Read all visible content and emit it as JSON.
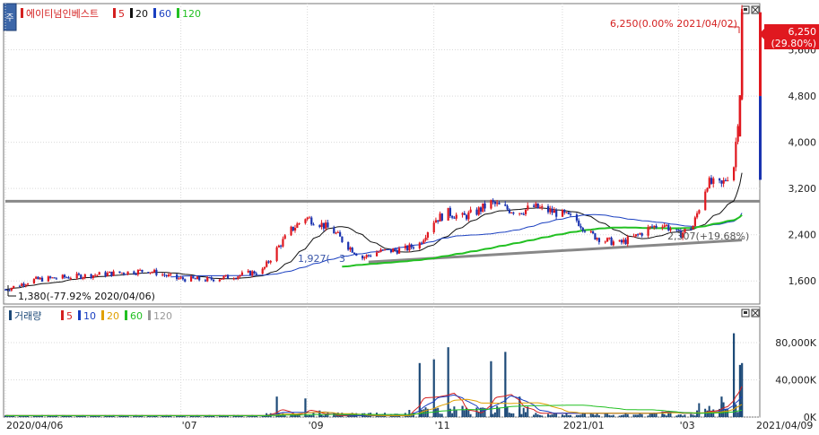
{
  "price_panel": {
    "stock_name": "에이티넘인베스트",
    "ma_labels": [
      "5",
      "20",
      "60",
      "120"
    ],
    "ma_colors": [
      "#d42020",
      "#111111",
      "#1a3fc0",
      "#22c022"
    ],
    "high_annotation": "6,250(0.00% 2021/04/02)",
    "low_annotation": "1,380(-77.92% 2020/04/06)",
    "trendline_annotation": "1,927(",
    "trendline_annotation_fragment": "3",
    "trendline_end_annotation": "2,307(+19.68%)",
    "current_price_label": "6,250",
    "current_change_label": "(29.80%)"
  },
  "volume_panel": {
    "title": "거래량",
    "ma_labels": [
      "5",
      "10",
      "20",
      "60",
      "120"
    ],
    "ma_colors": [
      "#d42020",
      "#1a3fc0",
      "#e0a000",
      "#22c022",
      "#999999"
    ]
  },
  "colors": {
    "up": "#e0181f",
    "down": "#1a33b0",
    "volume_bar": "#1d4a78",
    "support_line": "#888888",
    "current_price_bg": "#e0181f"
  },
  "chart_data": [
    {
      "type": "candlestick",
      "title": "에이티넘인베스트",
      "y_ticks": [
        "5,600",
        "4,800",
        "4,000",
        "3,200",
        "2,400",
        "1,600"
      ],
      "y_tick_values": [
        5600,
        4800,
        4000,
        3200,
        2400,
        1600
      ],
      "ylim": [
        1200,
        6400
      ],
      "x_ticks": [
        "2020/04/06",
        "'07",
        "'09",
        "'11",
        "2021/01",
        "'03",
        "2021/04/09"
      ],
      "x_tick_dates": [
        "2020-04-06",
        "2020-07-01",
        "2020-09-01",
        "2020-11-02",
        "2021-01-04",
        "2021-03-02",
        "2021-04-09"
      ],
      "x_range": [
        "2020-04-06",
        "2021-04-09"
      ],
      "period_low": {
        "date": "2020-04-06",
        "value": 1380
      },
      "period_high": {
        "date": "2021-04-02",
        "value": 6250
      },
      "last_close": 6250,
      "last_change_pct": 29.8,
      "horizontal_line": 2980,
      "support_trendline": {
        "start_date": "2020-10-01",
        "start_value": 1927,
        "end_date": "2021-04-02",
        "end_value": 2307
      },
      "series": [
        {
          "name": "Close",
          "points": [
            [
              "2020-04-06",
              1450
            ],
            [
              "2020-04-20",
              1620
            ],
            [
              "2020-05-04",
              1660
            ],
            [
              "2020-05-18",
              1700
            ],
            [
              "2020-06-01",
              1740
            ],
            [
              "2020-06-15",
              1780
            ],
            [
              "2020-06-29",
              1640
            ],
            [
              "2020-07-13",
              1620
            ],
            [
              "2020-07-27",
              1680
            ],
            [
              "2020-08-10",
              1780
            ],
            [
              "2020-08-17",
              2150
            ],
            [
              "2020-08-24",
              2480
            ],
            [
              "2020-08-31",
              2700
            ],
            [
              "2020-09-07",
              2600
            ],
            [
              "2020-09-14",
              2450
            ],
            [
              "2020-09-21",
              2200
            ],
            [
              "2020-09-28",
              2000
            ],
            [
              "2020-10-05",
              2100
            ],
            [
              "2020-10-19",
              2150
            ],
            [
              "2020-10-26",
              2250
            ],
            [
              "2020-11-02",
              2650
            ],
            [
              "2020-11-09",
              2780
            ],
            [
              "2020-11-16",
              2700
            ],
            [
              "2020-11-23",
              2800
            ],
            [
              "2020-11-30",
              2950
            ],
            [
              "2020-12-07",
              2850
            ],
            [
              "2020-12-14",
              2800
            ],
            [
              "2020-12-21",
              2880
            ],
            [
              "2021-01-04",
              2750
            ],
            [
              "2021-01-11",
              2650
            ],
            [
              "2021-01-18",
              2400
            ],
            [
              "2021-01-25",
              2300
            ],
            [
              "2021-02-01",
              2250
            ],
            [
              "2021-02-08",
              2350
            ],
            [
              "2021-02-15",
              2500
            ],
            [
              "2021-02-22",
              2600
            ],
            [
              "2021-03-02",
              2400
            ],
            [
              "2021-03-09",
              2550
            ],
            [
              "2021-03-16",
              3300
            ],
            [
              "2021-03-23",
              3250
            ],
            [
              "2021-03-29",
              3600
            ],
            [
              "2021-04-01",
              4814
            ],
            [
              "2021-04-02",
              6250
            ]
          ]
        },
        {
          "name": "Volume",
          "points": [
            [
              "2020-08-17",
              22000
            ],
            [
              "2020-08-31",
              20000
            ],
            [
              "2020-09-07",
              7000
            ],
            [
              "2020-10-26",
              58000
            ],
            [
              "2020-11-02",
              62000
            ],
            [
              "2020-11-09",
              75000
            ],
            [
              "2020-11-16",
              12000
            ],
            [
              "2020-11-30",
              60000
            ],
            [
              "2020-12-07",
              70000
            ],
            [
              "2020-12-14",
              22000
            ],
            [
              "2021-02-22",
              6000
            ],
            [
              "2021-03-16",
              7000
            ],
            [
              "2021-03-23",
              22000
            ],
            [
              "2021-03-29",
              90000
            ],
            [
              "2021-04-01",
              56000
            ],
            [
              "2021-04-02",
              58000
            ]
          ]
        }
      ]
    },
    {
      "type": "bar",
      "title": "거래량",
      "y_ticks": [
        "80,000K",
        "40,000K",
        "0K"
      ],
      "y_tick_values": [
        80000,
        40000,
        0
      ],
      "ylim": [
        0,
        105000
      ]
    }
  ]
}
